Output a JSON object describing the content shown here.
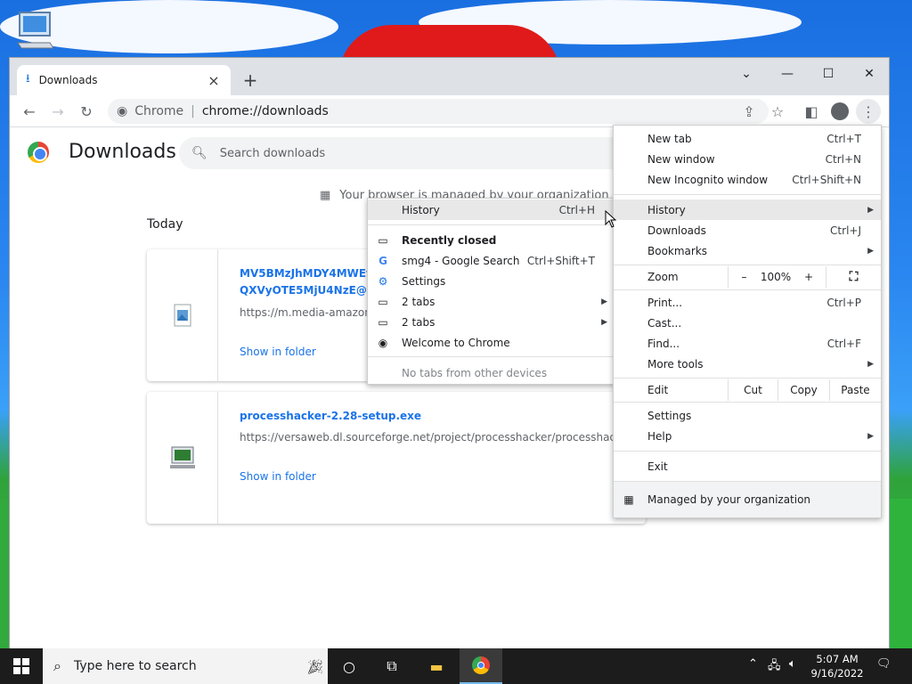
{
  "desktop": {
    "icon_label": "My Computer"
  },
  "browser": {
    "tab": {
      "title": "Downloads"
    },
    "omnibox": {
      "site": "Chrome",
      "sep": "|",
      "url": "chrome://downloads"
    }
  },
  "downloads_page": {
    "title": "Downloads",
    "search_placeholder": "Search downloads",
    "managed_note": "Your browser is managed by your organization",
    "section": "Today",
    "items": [
      {
        "name": "MV5BMzJhMDY4MWEtMDkzMy00OWNlLTg1ODUt\nQXVyOTE5MjU4NzE@._V1_.jpg",
        "url": "https://m.media-amazon.com/images/M/MV5BMzJhMDY4MWEtMDkzMy00OWNlLTg1ODUt",
        "action": "Show in folder"
      },
      {
        "name": "processhacker-2.28-setup.exe",
        "url": "https://versaweb.dl.sourceforge.net/project/processhacker/processhacker2/processhacker-2.28-setup.exe",
        "action": "Show in folder"
      }
    ]
  },
  "history_menu": {
    "history": {
      "label": "History",
      "shortcut": "Ctrl+H"
    },
    "recently_closed": "Recently closed",
    "items": [
      {
        "label": "smg4 - Google Search",
        "shortcut": "Ctrl+Shift+T",
        "icon": "google-icon"
      },
      {
        "label": "Settings",
        "shortcut": "",
        "icon": "gear-icon"
      },
      {
        "label": "2 tabs",
        "shortcut": "",
        "icon": "window-icon"
      },
      {
        "label": "2 tabs",
        "shortcut": "",
        "icon": "window-icon"
      },
      {
        "label": "Welcome to Chrome",
        "shortcut": "",
        "icon": "chrome-icon"
      }
    ],
    "no_tabs": "No tabs from other devices"
  },
  "main_menu": {
    "new_tab": {
      "label": "New tab",
      "shortcut": "Ctrl+T"
    },
    "new_window": {
      "label": "New window",
      "shortcut": "Ctrl+N"
    },
    "incognito": {
      "label": "New Incognito window",
      "shortcut": "Ctrl+Shift+N"
    },
    "history": {
      "label": "History"
    },
    "downloads": {
      "label": "Downloads",
      "shortcut": "Ctrl+J"
    },
    "bookmarks": {
      "label": "Bookmarks"
    },
    "zoom": {
      "label": "Zoom",
      "minus": "–",
      "value": "100%",
      "plus": "+"
    },
    "print": {
      "label": "Print...",
      "shortcut": "Ctrl+P"
    },
    "cast": {
      "label": "Cast..."
    },
    "find": {
      "label": "Find...",
      "shortcut": "Ctrl+F"
    },
    "more_tools": {
      "label": "More tools"
    },
    "edit": {
      "label": "Edit",
      "cut": "Cut",
      "copy": "Copy",
      "paste": "Paste"
    },
    "settings": {
      "label": "Settings"
    },
    "help": {
      "label": "Help"
    },
    "exit": {
      "label": "Exit"
    },
    "managed": {
      "label": "Managed by your organization"
    }
  },
  "taskbar": {
    "search_placeholder": "Type here to search",
    "time": "5:07 AM",
    "date": "9/16/2022"
  },
  "colors": {
    "accent": "#1a73e8",
    "taskbar": "#1c1c1c",
    "menu_highlight": "#e8e8e8"
  }
}
